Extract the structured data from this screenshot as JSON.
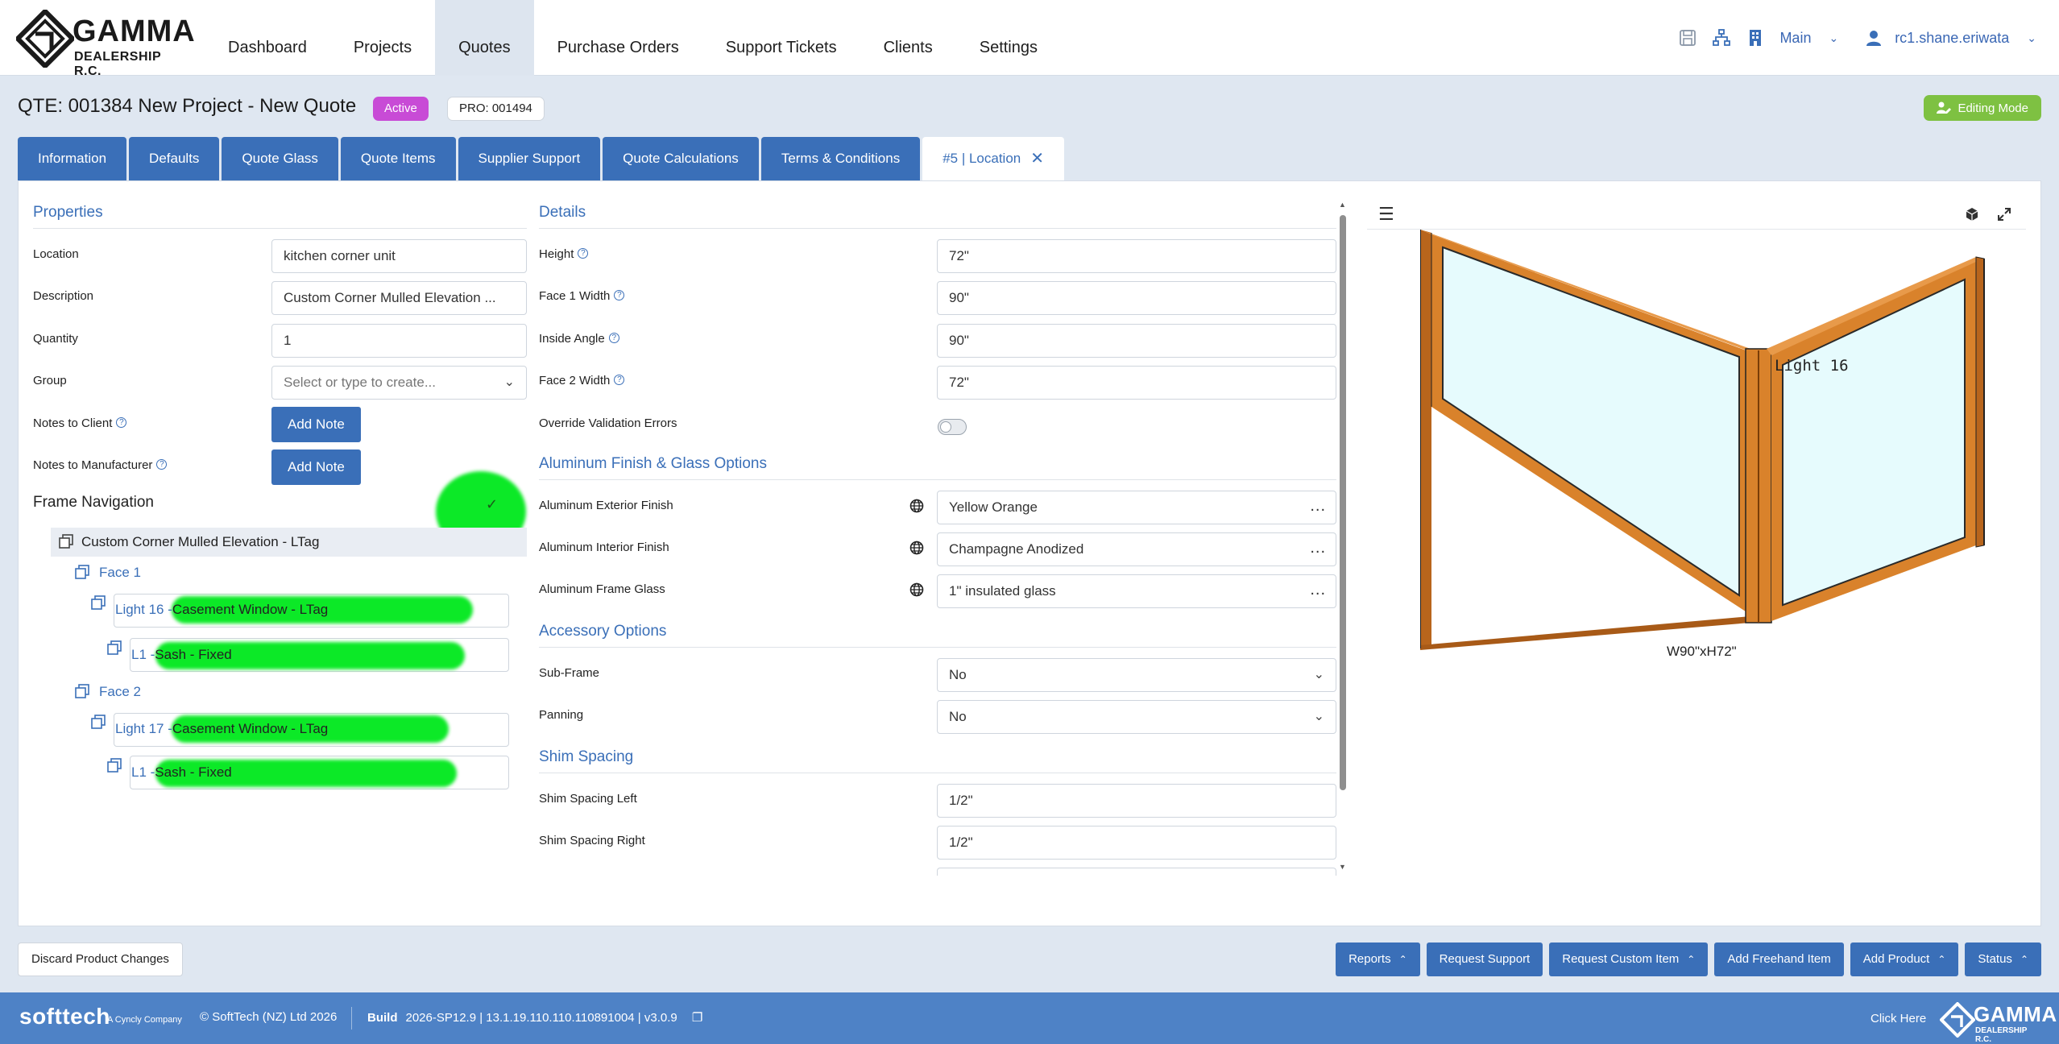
{
  "brand": {
    "name": "GAMMA",
    "subtitle": "DEALERSHIP R.C."
  },
  "nav": [
    {
      "label": "Dashboard"
    },
    {
      "label": "Projects"
    },
    {
      "label": "Quotes",
      "active": true
    },
    {
      "label": "Purchase Orders"
    },
    {
      "label": "Support Tickets"
    },
    {
      "label": "Clients"
    },
    {
      "label": "Settings"
    }
  ],
  "header_right": {
    "icons": [
      "save-icon",
      "sitemap-icon",
      "building-icon"
    ],
    "branch": "Main",
    "user": "rc1.shane.eriwata"
  },
  "quote": {
    "title": "QTE: 001384 New Project - New Quote",
    "status": "Active",
    "project": "PRO: 001494",
    "mode": "Editing Mode"
  },
  "tabs": [
    {
      "label": "Information"
    },
    {
      "label": "Defaults"
    },
    {
      "label": "Quote Glass"
    },
    {
      "label": "Quote Items"
    },
    {
      "label": "Supplier Support"
    },
    {
      "label": "Quote Calculations"
    },
    {
      "label": "Terms & Conditions"
    },
    {
      "label": "#5 | Location",
      "current": true
    }
  ],
  "properties": {
    "title": "Properties",
    "location_label": "Location",
    "location_value": "kitchen corner unit",
    "description_label": "Description",
    "description_value": "Custom Corner Mulled Elevation ...",
    "quantity_label": "Quantity",
    "quantity_value": "1",
    "group_label": "Group",
    "group_placeholder": "Select or type to create...",
    "notes_client_label": "Notes to Client",
    "notes_manufacturer_label": "Notes to Manufacturer",
    "add_note_label": "Add Note"
  },
  "frame_nav": {
    "title": "Frame Navigation",
    "root": "Custom Corner Mulled Elevation - LTag",
    "face1": "Face 1",
    "face1_light_prefix": "Light 16 -",
    "face1_light_name": "Casement Window - LTag",
    "face1_sash_prefix": "L1 -",
    "face1_sash_name": "Sash - Fixed",
    "face2": "Face 2",
    "face2_light_prefix": "Light 17 -",
    "face2_light_name": "Casement Window - LTag",
    "face2_sash_prefix": "L1 -",
    "face2_sash_name": "Sash - Fixed"
  },
  "details": {
    "title": "Details",
    "height_label": "Height",
    "height_value": "72\"",
    "face1_width_label": "Face 1 Width",
    "face1_width_value": "90\"",
    "inside_angle_label": "Inside Angle",
    "inside_angle_value": "90\"",
    "face2_width_label": "Face 2 Width",
    "face2_width_value": "72\"",
    "override_label": "Override Validation Errors",
    "override_on": false
  },
  "finish": {
    "title": "Aluminum Finish & Glass Options",
    "ext_label": "Aluminum Exterior Finish",
    "ext_value": "Yellow Orange",
    "int_label": "Aluminum Interior Finish",
    "int_value": "Champagne Anodized",
    "glass_label": "Aluminum Frame Glass",
    "glass_value": "1\" insulated glass",
    "more": "..."
  },
  "accessory": {
    "title": "Accessory Options",
    "subframe_label": "Sub-Frame",
    "subframe_value": "No",
    "panning_label": "Panning",
    "panning_value": "No"
  },
  "shim": {
    "title": "Shim Spacing",
    "left_label": "Shim Spacing Left",
    "left_value": "1/2\"",
    "right_label": "Shim Spacing Right",
    "right_value": "1/2\""
  },
  "preview": {
    "light_label": "Light 16",
    "dimension": "W90\"xH72\"",
    "frame_color": "#d9822b",
    "glass_color": "#e6fbfd"
  },
  "bottom": {
    "discard": "Discard Product Changes",
    "actions": [
      {
        "label": "Reports",
        "menu": true
      },
      {
        "label": "Request Support",
        "menu": false
      },
      {
        "label": "Request Custom Item",
        "menu": true
      },
      {
        "label": "Add Freehand Item",
        "menu": false
      },
      {
        "label": "Add Product",
        "menu": true
      },
      {
        "label": "Status",
        "menu": true
      }
    ]
  },
  "footer": {
    "company": "softtech",
    "company_sub": "A Cyncly Company",
    "copyright": "© SoftTech (NZ) Ltd 2026",
    "build_label": "Build",
    "build_value": "2026-SP12.9 | 13.1.19.110.110.110891004 | v3.0.9",
    "click_here": "Click Here",
    "brand_name": "GAMMA",
    "brand_sub": "DEALERSHIP R.C."
  },
  "colors": {
    "primary": "#3a6fb8",
    "active_badge": "#c84bd6",
    "editing": "#7ec142",
    "highlight": "#00e81c"
  }
}
